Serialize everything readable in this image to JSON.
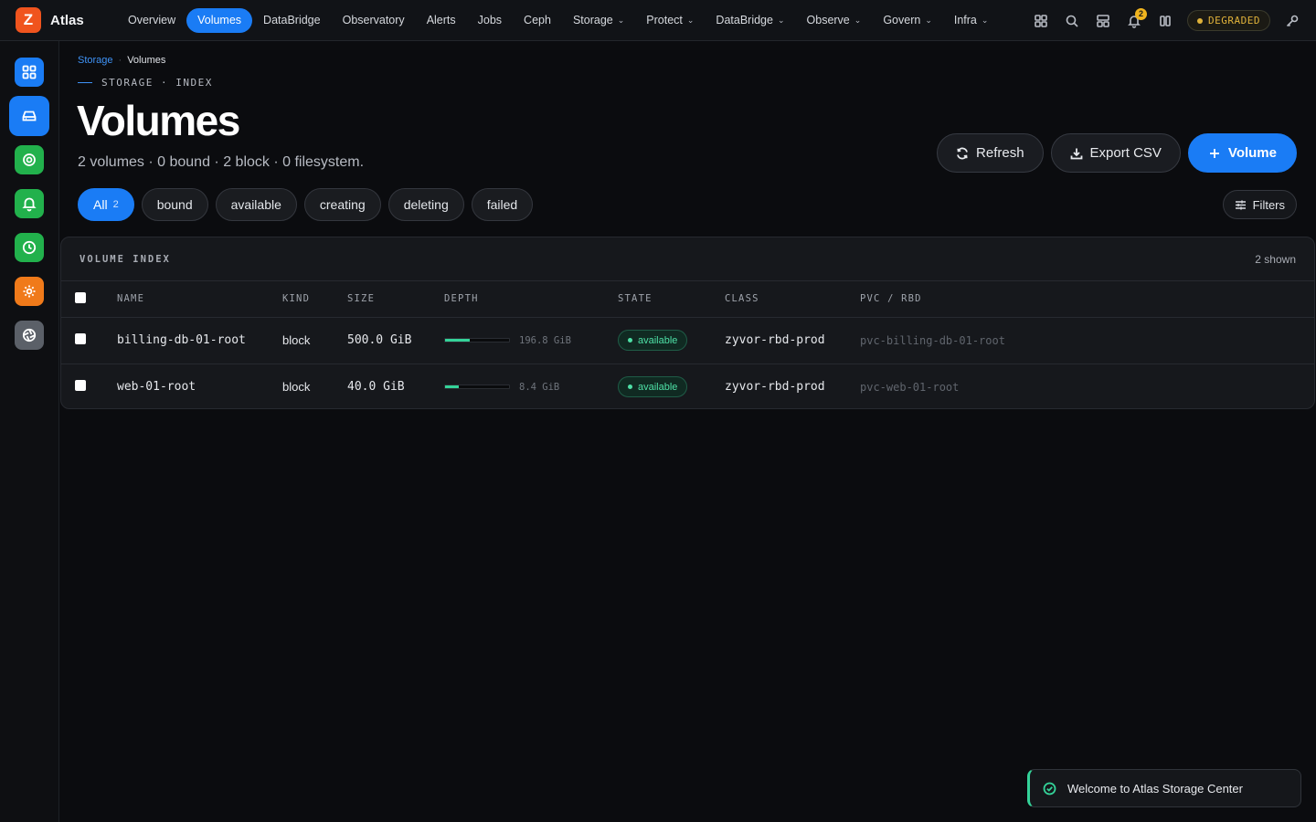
{
  "app": {
    "logo_letter": "Z",
    "name": "Atlas",
    "accent": "#1a7cf5"
  },
  "nav": {
    "items": [
      {
        "label": "Overview",
        "active": false,
        "dropdown": false
      },
      {
        "label": "Volumes",
        "active": true,
        "dropdown": false
      },
      {
        "label": "DataBridge",
        "active": false,
        "dropdown": false
      },
      {
        "label": "Observatory",
        "active": false,
        "dropdown": false
      },
      {
        "label": "Alerts",
        "active": false,
        "dropdown": false
      },
      {
        "label": "Jobs",
        "active": false,
        "dropdown": false
      },
      {
        "label": "Ceph",
        "active": false,
        "dropdown": false
      },
      {
        "label": "Storage",
        "active": false,
        "dropdown": true
      },
      {
        "label": "Protect",
        "active": false,
        "dropdown": true
      },
      {
        "label": "DataBridge",
        "active": false,
        "dropdown": true
      },
      {
        "label": "Observe",
        "active": false,
        "dropdown": true
      },
      {
        "label": "Govern",
        "active": false,
        "dropdown": true
      },
      {
        "label": "Infra",
        "active": false,
        "dropdown": true
      }
    ]
  },
  "topbar": {
    "icons": [
      "grid-icon",
      "search-icon",
      "layout-icon",
      "bell-icon",
      "columns-icon",
      "key-icon"
    ],
    "notification_count": "2",
    "status": "DEGRADED",
    "status_color": "#e0b23a"
  },
  "sidebar": {
    "items": [
      {
        "icon": "dashboard-icon",
        "color": "#1a7cf5"
      },
      {
        "icon": "drive-icon",
        "color": "#1a7cf5",
        "active": true
      },
      {
        "icon": "target-icon",
        "color": "#22b14c"
      },
      {
        "icon": "bell-icon",
        "color": "#22b14c"
      },
      {
        "icon": "clock-icon",
        "color": "#22b14c"
      },
      {
        "icon": "gear-icon",
        "color": "#f07a1a"
      },
      {
        "icon": "aperture-icon",
        "color": "#5b6068"
      }
    ]
  },
  "breadcrumb": {
    "parent": "Storage",
    "sep": "·",
    "current": "Volumes"
  },
  "header": {
    "eyebrow": "STORAGE · INDEX",
    "title": "Volumes",
    "subtitle": "2 volumes · 0 bound · 2 block · 0 filesystem."
  },
  "actions": {
    "refresh": "Refresh",
    "export": "Export CSV",
    "add_volume": "Volume"
  },
  "chips": [
    {
      "label": "All",
      "count": "2",
      "active": true
    },
    {
      "label": "bound",
      "active": false
    },
    {
      "label": "available",
      "active": false
    },
    {
      "label": "creating",
      "active": false
    },
    {
      "label": "deleting",
      "active": false
    },
    {
      "label": "failed",
      "active": false
    }
  ],
  "filters_label": "Filters",
  "table": {
    "title": "VOLUME INDEX",
    "shown": "2 shown",
    "columns": [
      "NAME",
      "KIND",
      "SIZE",
      "DEPTH",
      "STATE",
      "CLASS",
      "PVC / RBD"
    ],
    "rows": [
      {
        "name": "billing-db-01-root",
        "kind": "block",
        "size": "500.0 GiB",
        "depth_used": "196.8 GiB",
        "depth_fraction": 0.39,
        "state": "available",
        "class": "zyvor-rbd-prod",
        "pvc": "pvc-billing-db-01-root"
      },
      {
        "name": "web-01-root",
        "kind": "block",
        "size": "40.0 GiB",
        "depth_used": "8.4 GiB",
        "depth_fraction": 0.21,
        "state": "available",
        "class": "zyvor-rbd-prod",
        "pvc": "pvc-web-01-root"
      }
    ]
  },
  "toast": {
    "message": "Welcome to Atlas Storage Center"
  }
}
